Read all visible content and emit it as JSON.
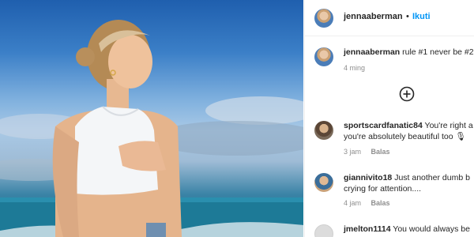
{
  "post": {
    "username": "jennaaberman",
    "separator": "•",
    "follow_label": "Ikuti",
    "caption_text": "rule #1 never be #2",
    "caption_time": "4 ming"
  },
  "load_more_icon": "plus-circle-icon",
  "comments": [
    {
      "username": "sportscardfanatic84",
      "line1": "You're right a",
      "line2": "you're absolutely beautiful too 🎙",
      "time": "3 jam",
      "reply_label": "Balas"
    },
    {
      "username": "giannivito18",
      "line1": "Just another dumb b",
      "line2": "crying for attention....",
      "time": "4 jam",
      "reply_label": "Balas"
    },
    {
      "username": "jmelton1114",
      "line1": "You would always be",
      "line2": "",
      "time": "",
      "reply_label": ""
    }
  ],
  "colors": {
    "follow": "#0095f6",
    "muted": "#8e8e8e",
    "text": "#262626"
  }
}
